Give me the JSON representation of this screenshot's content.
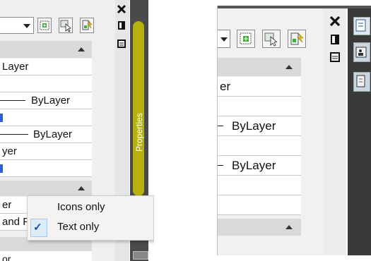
{
  "left_panel": {
    "rows": [
      "Layer",
      "",
      "ByLayer",
      "",
      "ByLayer",
      "yer",
      ""
    ],
    "context_menu": {
      "items": [
        {
          "label": "Icons only",
          "checked": false
        },
        {
          "label": "Text only",
          "checked": true
        }
      ],
      "check_glyph": "✓"
    },
    "lower_rows": [
      "er",
      "and P",
      "or"
    ],
    "palette_tab_label": "Properties",
    "highlight_color": "#c8c400"
  },
  "right_panel": {
    "rows": [
      "er",
      "",
      "ByLayer",
      "",
      "ByLayer",
      "",
      ""
    ]
  },
  "icons": {
    "close": "close-icon",
    "autohide": "auto-hide-icon",
    "properties": "properties-menu-icon",
    "quick_select": "quick-select-icon",
    "select_objects": "select-objects-icon",
    "toggle_pickadd": "toggle-pickadd-icon"
  }
}
